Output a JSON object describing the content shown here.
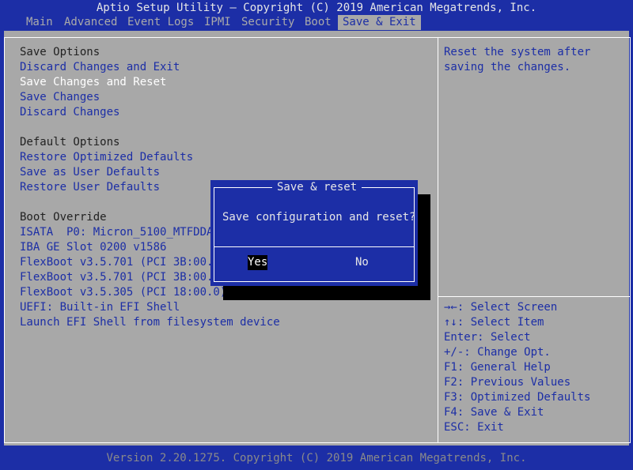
{
  "title": "Aptio Setup Utility – Copyright (C) 2019 American Megatrends, Inc.",
  "tabs": [
    {
      "label": "Main"
    },
    {
      "label": "Advanced"
    },
    {
      "label": "Event Logs"
    },
    {
      "label": "IPMI"
    },
    {
      "label": "Security"
    },
    {
      "label": "Boot"
    },
    {
      "label": "Save & Exit",
      "active": true
    }
  ],
  "menu": {
    "save_options_header": "Save Options",
    "discard_changes_and_exit": "Discard Changes and Exit",
    "save_changes_and_reset": "Save Changes and Reset",
    "save_changes": "Save Changes",
    "discard_changes": "Discard Changes",
    "default_options_header": "Default Options",
    "restore_optimized_defaults": "Restore Optimized Defaults",
    "save_as_user_defaults": "Save as User Defaults",
    "restore_user_defaults": "Restore User Defaults",
    "boot_override_header": "Boot Override",
    "boot_items": [
      "ISATA  P0: Micron_5100_MTFDDAV",
      "IBA GE Slot 0200 v1586",
      "FlexBoot v3.5.701 (PCI 3B:00.0",
      "FlexBoot v3.5.701 (PCI 3B:00.1",
      "FlexBoot v3.5.305 (PCI 18:00.0)",
      "UEFI: Built-in EFI Shell",
      "Launch EFI Shell from filesystem device"
    ]
  },
  "help": {
    "line1": "Reset the system after",
    "line2": "saving the changes."
  },
  "key_help": [
    "→←: Select Screen",
    "↑↓: Select Item",
    "Enter: Select",
    "+/-: Change Opt.",
    "F1: General Help",
    "F2: Previous Values",
    "F3: Optimized Defaults",
    "F4: Save & Exit",
    "ESC: Exit"
  ],
  "dialog": {
    "title": "Save & reset",
    "message": "Save configuration and reset?",
    "yes_label": "Yes",
    "no_label": "No"
  },
  "footer": "Version 2.20.1275. Copyright (C) 2019 American Megatrends, Inc.",
  "colors": {
    "bios_blue": "#1c2ea6",
    "panel_gray": "#a8a8a8",
    "selected_text": "#ffffff",
    "section_text": "#222222"
  }
}
